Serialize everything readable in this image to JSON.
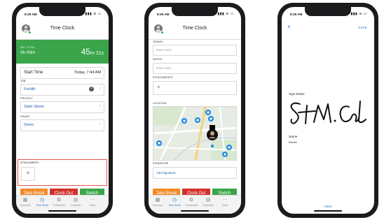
{
  "status": {
    "time": "8:29 AM",
    "icons": "▮▮▮ ≋ ▭"
  },
  "phone1": {
    "title": "Time Clock",
    "day_total_label": "DAY TOTAL",
    "day_total_value": "0h 00m",
    "elapsed_main": "45",
    "elapsed_sub": "m 21s",
    "start_time_label": "Start Time",
    "start_time_value": "Today, 7:44 AM",
    "job_label": "JOB",
    "job_value": "Forklift",
    "project_label": "PROJECT",
    "project_value": "State Street",
    "phase_label": "PHASE",
    "phase_value": "Demo",
    "attachments_label": "ATTACHMENTS",
    "add_symbol": "+",
    "buttons": {
      "take_break": "Take Break",
      "clock_out": "Clock Out",
      "switch": "Switch"
    }
  },
  "phone2": {
    "title": "Time Clock",
    "travel_label": "TRAVEL",
    "travel_placeholder": "Enter travel",
    "notes_label": "NOTES",
    "notes_placeholder": "Enter notes",
    "attachments_label": "ATTACHMENTS",
    "add_symbol": "+",
    "location_label": "LOCATION",
    "signature_label": "SIGNATURE",
    "add_signature": "Add Signature",
    "buttons": {
      "take_break": "Take Break",
      "clock_out": "Clock Out",
      "switch": "Switch"
    }
  },
  "phone3": {
    "close": "×",
    "save": "SAVE",
    "sign_below": "Sign below",
    "name_label": "Name",
    "name_value": "Stevell",
    "clear": "Clear"
  },
  "tabs": [
    {
      "label": "Overview",
      "icon": "overview-icon",
      "glyph": "▦",
      "active": false
    },
    {
      "label": "Time Clock",
      "icon": "clock-icon",
      "glyph": "◷",
      "active": true
    },
    {
      "label": "Timesheets",
      "icon": "timesheets-icon",
      "glyph": "⧉",
      "active": false
    },
    {
      "label": "Schedule",
      "icon": "calendar-icon",
      "glyph": "▤",
      "active": false
    },
    {
      "label": "More",
      "icon": "more-icon",
      "glyph": "⋯",
      "active": false
    }
  ],
  "colors": {
    "green": "#3aa54a",
    "orange": "#f28a26",
    "red": "#d3302a",
    "link_blue": "#1e5fb4",
    "active_tab": "#1e6fd0"
  }
}
